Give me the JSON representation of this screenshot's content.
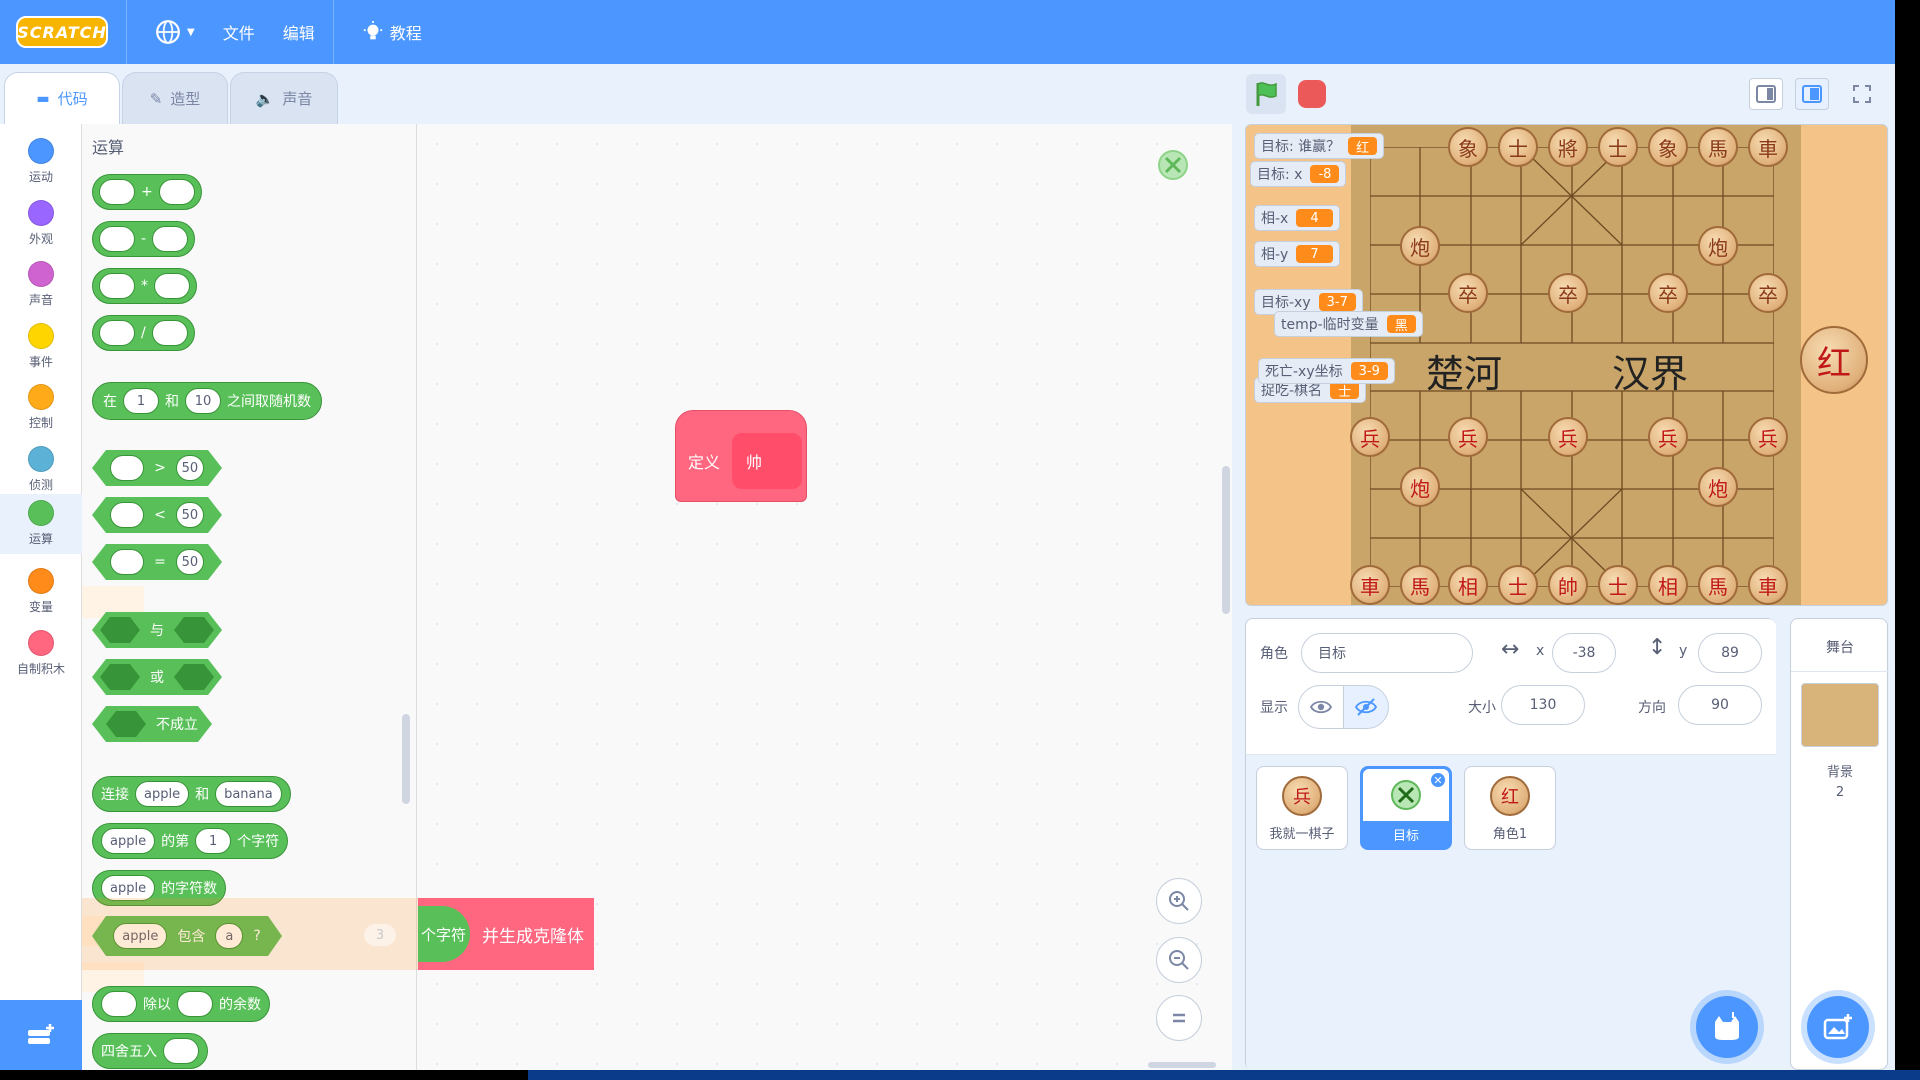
{
  "menu": {
    "logo": "SCRATCH",
    "file": "文件",
    "edit": "编辑",
    "tutorials": "教程"
  },
  "tabs": {
    "code": "代码",
    "costumes": "造型",
    "sounds": "声音"
  },
  "categories": [
    {
      "label": "运动",
      "color": "#4c97ff"
    },
    {
      "label": "外观",
      "color": "#9966ff"
    },
    {
      "label": "声音",
      "color": "#cf63cf"
    },
    {
      "label": "事件",
      "color": "#ffd500"
    },
    {
      "label": "控制",
      "color": "#ffab19"
    },
    {
      "label": "侦测",
      "color": "#5cb1d6"
    },
    {
      "label": "运算",
      "color": "#59c059"
    },
    {
      "label": "变量",
      "color": "#ff8c1a"
    },
    {
      "label": "自制积木",
      "color": "#ff6680"
    }
  ],
  "palette": {
    "title": "运算",
    "ops": [
      "+",
      "-",
      "*",
      "/"
    ],
    "random": {
      "prefix": "在",
      "from": "1",
      "and": "和",
      "to": "10",
      "suffix": "之间取随机数"
    },
    "gt": {
      "op": ">",
      "value": "50"
    },
    "lt": {
      "op": "<",
      "value": "50"
    },
    "eq": {
      "op": "=",
      "value": "50"
    },
    "and": "与",
    "or": "或",
    "not": "不成立",
    "join": {
      "label": "连接",
      "a": "apple",
      "and": "和",
      "b": "banana"
    },
    "letter": {
      "word": "apple",
      "of": "的第",
      "index": "1",
      "unit": "个字符"
    },
    "length": {
      "word": "apple",
      "label": "的字符数"
    },
    "contains": {
      "word": "apple",
      "label": "包含",
      "char": "a",
      "q": "?"
    },
    "ghost_index": "3",
    "mod": {
      "label1": "除以",
      "label2": "的余数"
    },
    "round": "四舍五入"
  },
  "workspace": {
    "define_label": "定义",
    "define_name": "帅",
    "drag_tail_label": "个字符",
    "clone_label": "并生成克隆体"
  },
  "monitors": [
    {
      "label": "目标: 谁赢？",
      "value": "红"
    },
    {
      "label": "目标: x",
      "value": "-8"
    },
    {
      "label": "相-x",
      "value": "4"
    },
    {
      "label": "相-y",
      "value": "7"
    },
    {
      "label": "目标-xy",
      "value": "3-7"
    },
    {
      "label": "temp-临时变量",
      "value": "黑"
    },
    {
      "label": "死亡-xy坐标",
      "value": "3-9"
    },
    {
      "label": "捉吃-棋名",
      "value": "士"
    }
  ],
  "board": {
    "black_top": [
      "象",
      "士",
      "將",
      "士",
      "象",
      "馬",
      "車"
    ],
    "black_cannons": [
      "炮",
      "炮"
    ],
    "black_soldiers": [
      "卒",
      "卒",
      "卒",
      "卒",
      "卒"
    ],
    "river_left": "楚河",
    "river_right": "汉界",
    "red_soldiers": [
      "兵",
      "兵",
      "兵",
      "兵",
      "兵"
    ],
    "red_cannons": [
      "炮",
      "炮"
    ],
    "red_bottom": [
      "車",
      "馬",
      "相",
      "士",
      "帥",
      "士",
      "相",
      "馬",
      "車"
    ],
    "turn_piece": "红"
  },
  "sprite_info": {
    "sprite_label": "角色",
    "sprite_name": "目标",
    "x_label": "x",
    "x": "-38",
    "y_label": "y",
    "y": "89",
    "show_label": "显示",
    "size_label": "大小",
    "size": "130",
    "direction_label": "方向",
    "direction": "90"
  },
  "sprites": [
    {
      "name": "我就一棋子",
      "glyph": "兵"
    },
    {
      "name": "目标",
      "glyph": ""
    },
    {
      "name": "角色1",
      "glyph": "红"
    }
  ],
  "stage_pane": {
    "title": "舞台",
    "backdrops_label": "背景",
    "backdrops_count": "2"
  }
}
